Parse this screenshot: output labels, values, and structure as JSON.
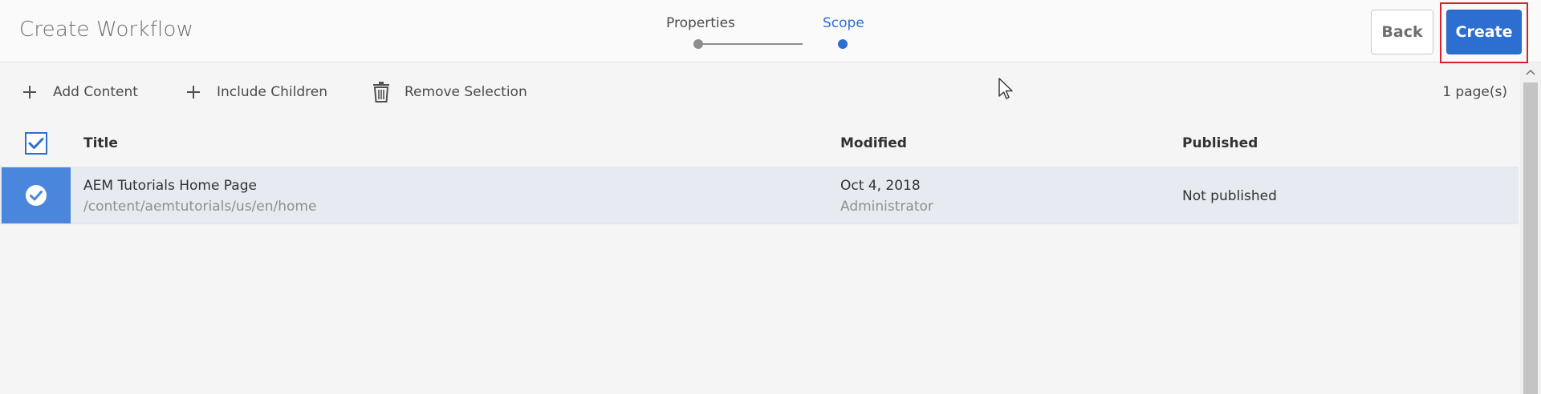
{
  "header": {
    "title": "Create Workflow",
    "back_label": "Back",
    "create_label": "Create"
  },
  "stepper": {
    "steps": [
      {
        "label": "Properties",
        "state": "done"
      },
      {
        "label": "Scope",
        "state": "current"
      }
    ]
  },
  "toolbar": {
    "add_content": "Add Content",
    "include_children": "Include Children",
    "remove_selection": "Remove Selection",
    "page_count": "1 page(s)"
  },
  "table": {
    "columns": {
      "title": "Title",
      "modified": "Modified",
      "published": "Published"
    },
    "rows": [
      {
        "title": "AEM Tutorials Home Page",
        "path": "/content/aemtutorials/us/en/home",
        "modified_date": "Oct 4, 2018",
        "modified_by": "Administrator",
        "published": "Not published",
        "selected": true
      }
    ]
  },
  "colors": {
    "accent": "#2d6fd0",
    "selected_row": "#e6ebf2",
    "selection_cell": "#4a86dc",
    "highlight": "#d9202a"
  },
  "icons": {
    "add_content": "plus-icon",
    "include_children": "plus-icon",
    "remove_selection": "trash-icon",
    "header_checkbox": "checkmark-icon",
    "row_check": "check-circle-icon"
  }
}
